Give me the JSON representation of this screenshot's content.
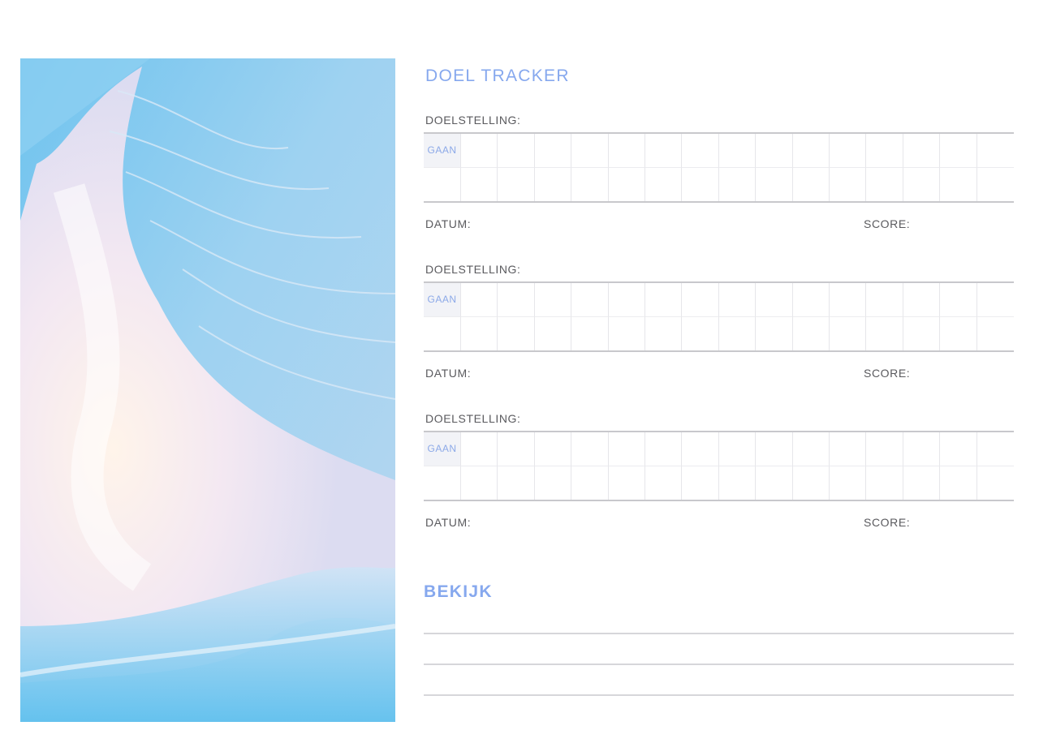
{
  "title": "DOEL TRACKER",
  "goals": [
    {
      "goal_label": "DOELSTELLING:",
      "go_label": "GAAN",
      "date_label": "DATUM:",
      "score_label": "SCORE:"
    },
    {
      "goal_label": "DOELSTELLING:",
      "go_label": "GAAN",
      "date_label": "DATUM:",
      "score_label": "SCORE:"
    },
    {
      "goal_label": "DOELSTELLING:",
      "go_label": "GAAN",
      "date_label": "DATUM:",
      "score_label": "SCORE:"
    }
  ],
  "review": {
    "title": "BEKIJK"
  },
  "colors": {
    "accent": "#86a8ee",
    "label": "#5a5a5e",
    "rule": "#c8c8cc"
  }
}
